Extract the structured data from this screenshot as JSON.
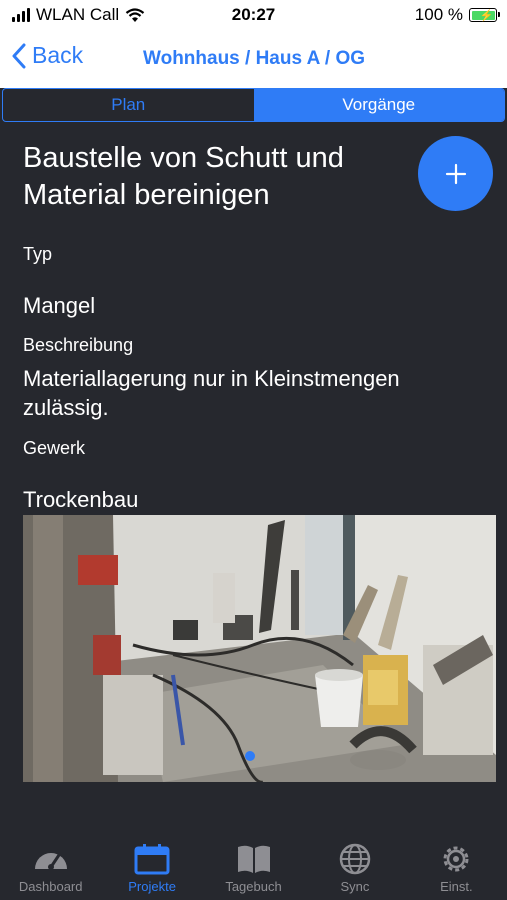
{
  "status": {
    "carrier": "WLAN Call",
    "time": "20:27",
    "battery": "100 %"
  },
  "nav": {
    "back": "Back",
    "title": "Wohnhaus / Haus A / OG"
  },
  "segments": [
    {
      "label": "Plan",
      "active": false
    },
    {
      "label": "Vorgänge",
      "active": true
    }
  ],
  "detail": {
    "title": "Baustelle von Schutt und Material bereinigen",
    "type_label": "Typ",
    "type_value": "Mangel",
    "description_label": "Beschreibung",
    "description_value": "Materiallagerung nur in Kleinstmengen zulässig.",
    "trade_label": "Gewerk",
    "trade_value": "Trockenbau"
  },
  "photo": {
    "page_index": 1,
    "page_count": 1
  },
  "tabs": [
    {
      "label": "Dashboard",
      "icon": "speedometer-icon",
      "active": false
    },
    {
      "label": "Projekte",
      "icon": "calendar-icon",
      "active": true
    },
    {
      "label": "Tagebuch",
      "icon": "book-icon",
      "active": false
    },
    {
      "label": "Sync",
      "icon": "globe-icon",
      "active": false
    },
    {
      "label": "Einst.",
      "icon": "gear-icon",
      "active": false
    }
  ],
  "colors": {
    "accent": "#2f7cf6",
    "background": "#26282e",
    "inactive": "#8e8e93",
    "battery": "#4cd964"
  }
}
